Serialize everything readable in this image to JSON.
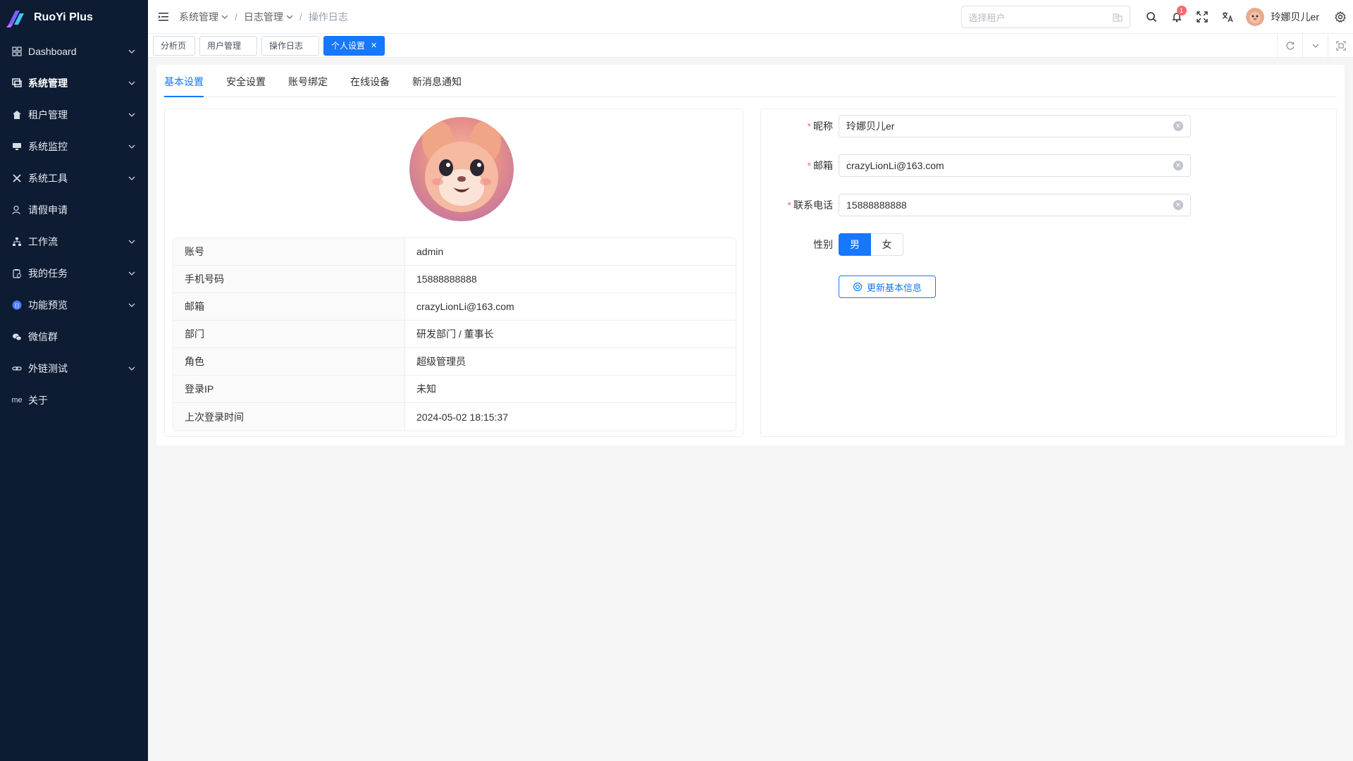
{
  "brand": {
    "title": "RuoYi Plus"
  },
  "sidebar": {
    "items": [
      {
        "label": "Dashboard",
        "icon": "dashboard-icon",
        "has_children": true
      },
      {
        "label": "系统管理",
        "icon": "system-icon",
        "has_children": true,
        "active": true
      },
      {
        "label": "租户管理",
        "icon": "home-icon",
        "has_children": true
      },
      {
        "label": "系统监控",
        "icon": "monitor-icon",
        "has_children": true
      },
      {
        "label": "系统工具",
        "icon": "tools-icon",
        "has_children": true
      },
      {
        "label": "请假申请",
        "icon": "user-icon",
        "has_children": false
      },
      {
        "label": "工作流",
        "icon": "workflow-icon",
        "has_children": true
      },
      {
        "label": "我的任务",
        "icon": "task-icon",
        "has_children": true
      },
      {
        "label": "功能预览",
        "icon": "preview-icon",
        "has_children": true
      },
      {
        "label": "微信群",
        "icon": "wechat-icon",
        "has_children": false
      },
      {
        "label": "外链测试",
        "icon": "link-icon",
        "has_children": true
      },
      {
        "label": "关于",
        "icon": "me-icon",
        "icon_text": "me",
        "has_children": false
      }
    ]
  },
  "header": {
    "breadcrumb": [
      "系统管理",
      "日志管理",
      "操作日志"
    ],
    "tenant_placeholder": "选择租户",
    "notification_count": "1",
    "user_name": "玲娜贝儿er"
  },
  "tags": [
    {
      "label": "分析页",
      "active": false
    },
    {
      "label": "用户管理",
      "active": false
    },
    {
      "label": "操作日志",
      "active": false
    },
    {
      "label": "个人设置",
      "active": true
    }
  ],
  "tabs": [
    {
      "label": "基本设置",
      "active": true
    },
    {
      "label": "安全设置",
      "active": false
    },
    {
      "label": "账号绑定",
      "active": false
    },
    {
      "label": "在线设备",
      "active": false
    },
    {
      "label": "新消息通知",
      "active": false
    }
  ],
  "profile": {
    "rows": [
      {
        "label": "账号",
        "value": "admin"
      },
      {
        "label": "手机号码",
        "value": "15888888888"
      },
      {
        "label": "邮箱",
        "value": "crazyLionLi@163.com"
      },
      {
        "label": "部门",
        "value": "研发部门 / 董事长"
      },
      {
        "label": "角色",
        "value": "超级管理员"
      },
      {
        "label": "登录IP",
        "value": "未知"
      },
      {
        "label": "上次登录时间",
        "value": "2024-05-02 18:15:37"
      }
    ]
  },
  "form": {
    "nickname_label": "昵称",
    "nickname_value": "玲娜贝儿er",
    "email_label": "邮箱",
    "email_value": "crazyLionLi@163.com",
    "phone_label": "联系电话",
    "phone_value": "15888888888",
    "gender_label": "性别",
    "gender_options": [
      "男",
      "女"
    ],
    "gender_selected": "男",
    "submit_label": "更新基本信息"
  },
  "colors": {
    "primary": "#1677ff",
    "sidebar_bg": "#0d1b33",
    "required": "#f56c6c"
  }
}
